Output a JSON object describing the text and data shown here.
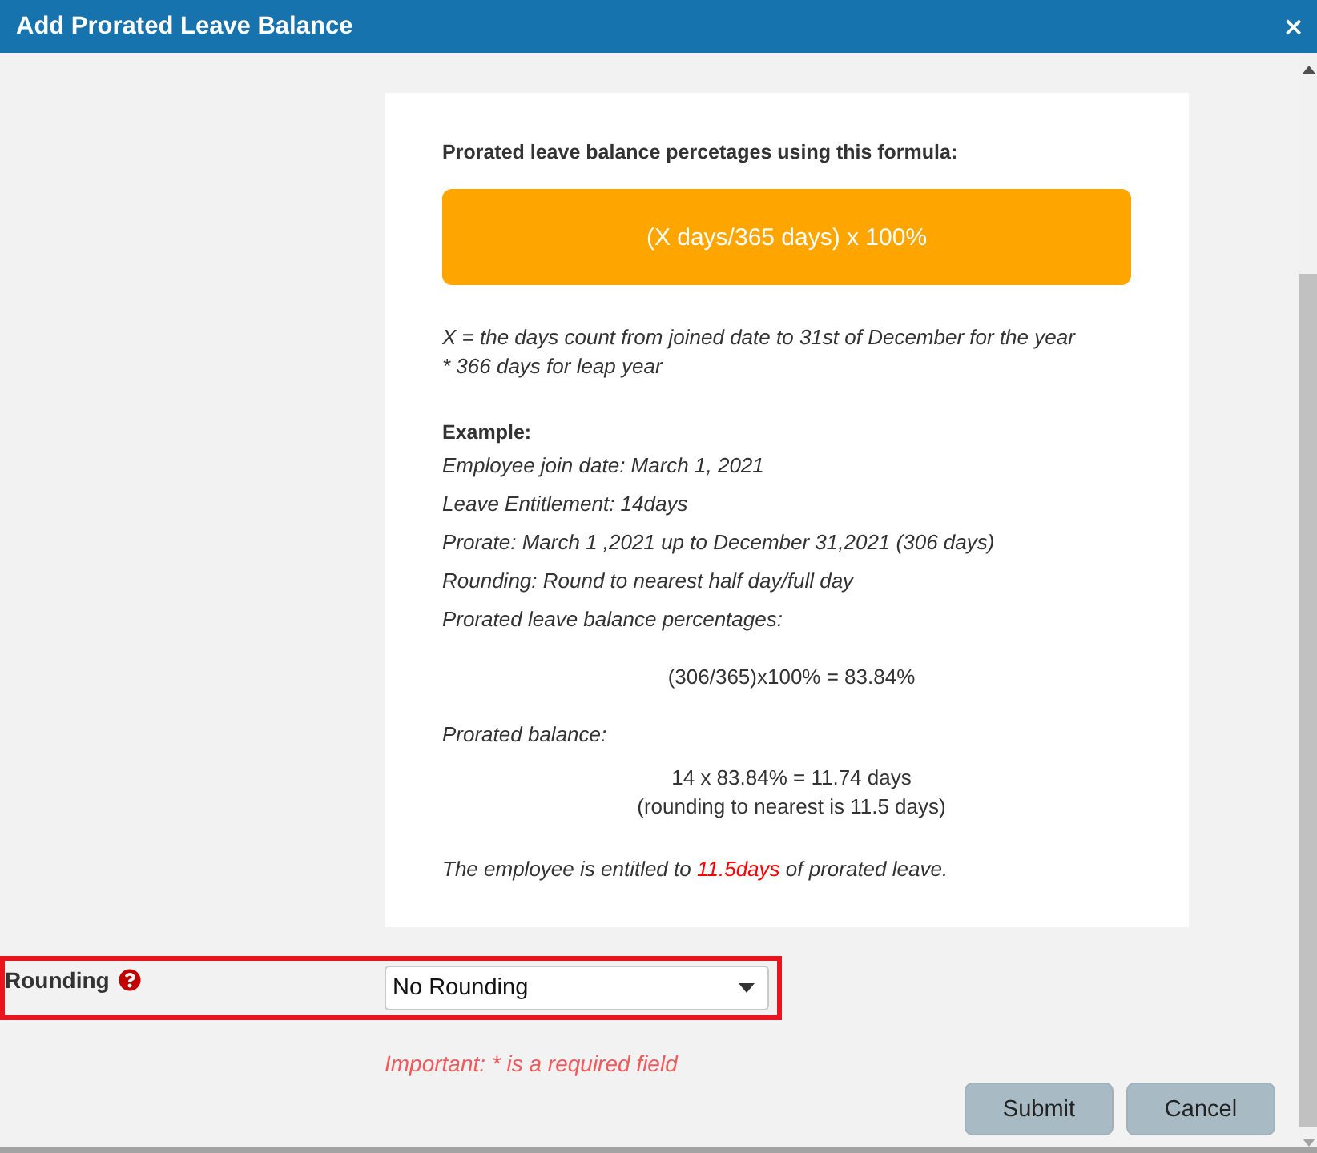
{
  "window": {
    "title": "Add Prorated Leave Balance",
    "close": "×"
  },
  "info_card": {
    "heading": "Prorated leave balance percetages using this formula:",
    "formula": "(X days/365 days) x 100%",
    "notes": [
      "X = the days count from joined date to 31st of December for the year",
      "* 366 days for leap year"
    ],
    "example": {
      "heading": "Example:",
      "lines": [
        "Employee join date: March 1, 2021",
        "Leave Entitlement: 14days",
        "Prorate: March 1 ,2021 up to December 31,2021 (306 days)",
        "Rounding: Round to nearest half day/full day",
        "Prorated leave balance percentages:"
      ],
      "calculation": "(306/365)x100% = 83.84%",
      "balance_label": "Prorated balance:",
      "balance_lines": [
        "14 x 83.84% = 11.74 days",
        "(rounding to nearest is 11.5 days)"
      ],
      "conclusion": [
        {
          "text": "The employee is entitled to ",
          "highlight": false
        },
        {
          "text": "11.5days",
          "highlight": true
        },
        {
          "text": " of prorated leave.",
          "highlight": false
        }
      ]
    }
  },
  "rounding": {
    "label": "Rounding",
    "value": "No Rounding",
    "outlined": true
  },
  "required_note": "Important: * is a required field",
  "buttons": [
    "Submit",
    "Cancel"
  ]
}
